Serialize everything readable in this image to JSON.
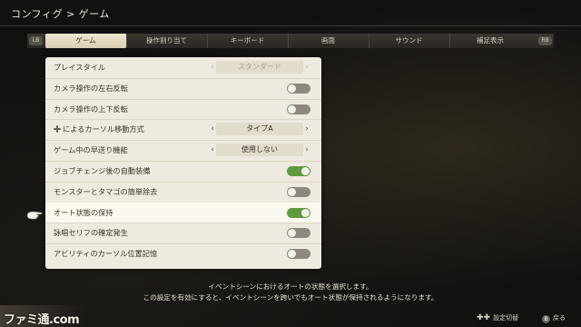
{
  "header": {
    "title": "コンフィグ > ゲーム"
  },
  "tabs": {
    "left_bumper": "LB",
    "right_bumper": "RB",
    "items": [
      {
        "label": "ゲーム",
        "active": true
      },
      {
        "label": "操作割り当て"
      },
      {
        "label": "キーボード"
      },
      {
        "label": "画面"
      },
      {
        "label": "サウンド"
      },
      {
        "label": "補足表示"
      }
    ]
  },
  "settings": {
    "rows": [
      {
        "label": "プレイスタイル",
        "type": "select",
        "value": "スタンダード",
        "disabled": true
      },
      {
        "label": "カメラ操作の左右反転",
        "type": "toggle",
        "on": false
      },
      {
        "label": "カメラ操作の上下反転",
        "type": "toggle",
        "on": false
      },
      {
        "label": "によるカーソル移動方式",
        "type": "select",
        "value": "タイプA",
        "icon": "dpad-icon"
      },
      {
        "label": "ゲーム中の早送り機能",
        "type": "select",
        "value": "使用しない"
      },
      {
        "label": "ジョブチェンジ後の自動装備",
        "type": "toggle",
        "on": true
      },
      {
        "label": "モンスターとタマゴの簡単除去",
        "type": "toggle",
        "on": false
      },
      {
        "label": "オート状態の保持",
        "type": "toggle",
        "on": true,
        "selected": true
      },
      {
        "label": "詠唱セリフの確定発生",
        "type": "toggle",
        "on": false
      },
      {
        "label": "アビリティのカーソル位置記憶",
        "type": "toggle",
        "on": false
      }
    ]
  },
  "description": {
    "line1": "イベントシーンにおけるオートの状態を選択します。",
    "line2": "この設定を有効にすると、イベントシーンを跨いでもオート状態が保持されるようになります。"
  },
  "footer": {
    "logo": "ファミ通.com",
    "hint_switch_label": "設定切替",
    "hint_back_glyph": "B",
    "hint_back_label": "戻る"
  },
  "colors": {
    "toggle_on": "#5f9a3f",
    "toggle_off": "#8e887d",
    "panel": "#efeadf"
  }
}
